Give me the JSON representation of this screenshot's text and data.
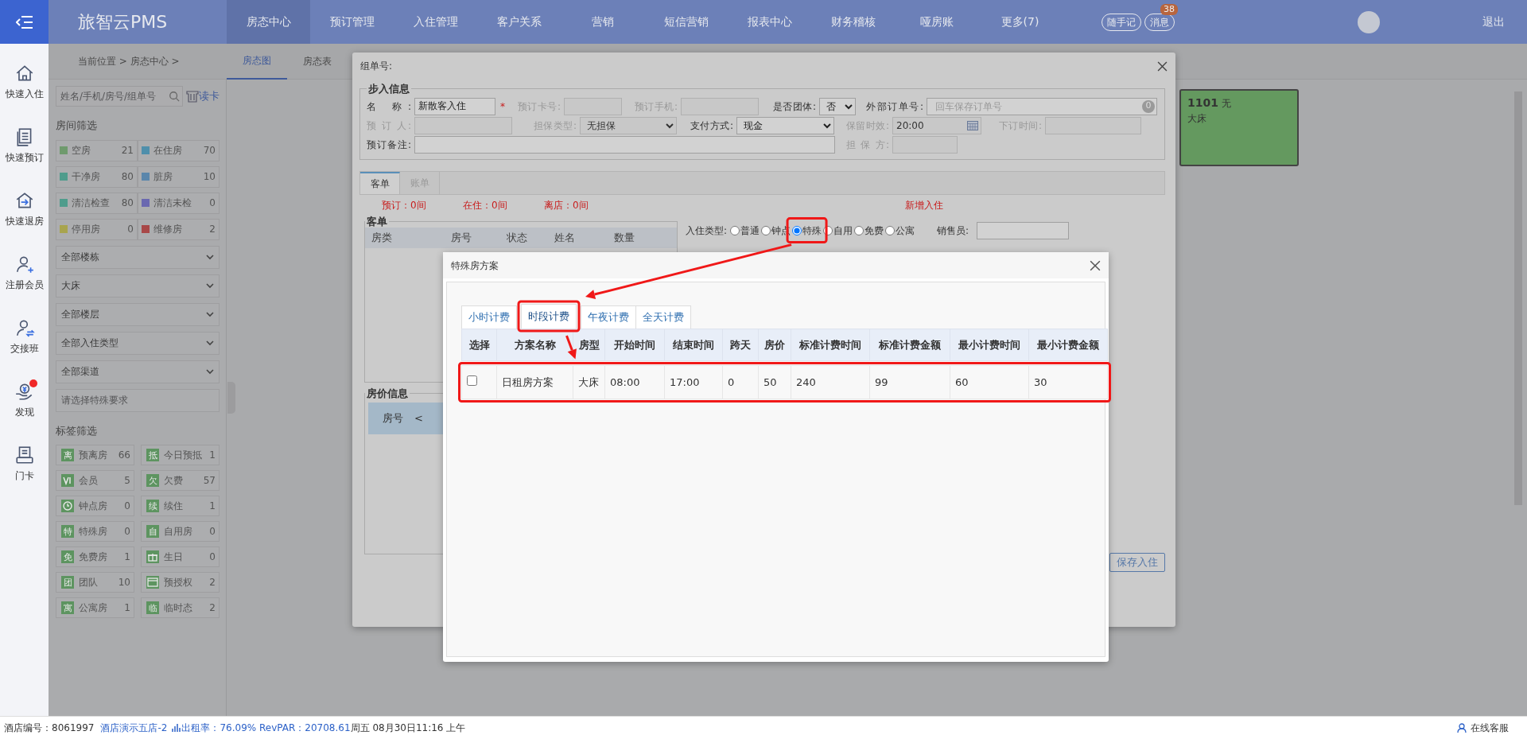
{
  "top_nav": {
    "logo": "旅智云PMS",
    "items": [
      {
        "label": "房态中心",
        "selected": true
      },
      {
        "label": "预订管理",
        "selected": false
      },
      {
        "label": "入住管理",
        "selected": false
      },
      {
        "label": "客户关系",
        "selected": false
      },
      {
        "label": "营销",
        "selected": false
      },
      {
        "label": "短信营销",
        "selected": false
      },
      {
        "label": "报表中心",
        "selected": false
      },
      {
        "label": "财务稽核",
        "selected": false
      },
      {
        "label": "哑房账",
        "selected": false
      },
      {
        "label": "更多(7)",
        "selected": false
      }
    ],
    "notes_button": "随手记",
    "messages_button": "消息",
    "messages_count": "38",
    "logout": "退出"
  },
  "rail": [
    {
      "label": "快速入住",
      "kind": "home",
      "badge_dot": false
    },
    {
      "label": "快速预订",
      "kind": "list",
      "badge_dot": false
    },
    {
      "label": "快速退房",
      "kind": "exit",
      "badge_dot": false
    },
    {
      "label": "注册会员",
      "kind": "user-add",
      "badge_dot": false
    },
    {
      "label": "交接班",
      "kind": "user-swap",
      "badge_dot": false
    },
    {
      "label": "发现",
      "kind": "money-hand",
      "badge_dot": true
    },
    {
      "label": "门卡",
      "kind": "card",
      "badge_dot": false
    }
  ],
  "breadcrumb": {
    "path": "当前位置 > 房态中心 >",
    "tabs": [
      {
        "label": "房态图",
        "selected": true
      },
      {
        "label": "房态表",
        "selected": false
      }
    ]
  },
  "filter_panel": {
    "search_placeholder": "姓名/手机/房号/组单号",
    "read_card": "读卡",
    "room_filter_title": "房间筛选",
    "room_statuses": [
      {
        "label": "空房",
        "count": "21",
        "color": "#6f9a6d"
      },
      {
        "label": "在住房",
        "count": "70",
        "color": "#4f8fab"
      },
      {
        "label": "干净房",
        "count": "80",
        "color": "#4f9c8c"
      },
      {
        "label": "脏房",
        "count": "10",
        "color": "#5a86ab"
      },
      {
        "label": "清洁检查",
        "count": "80",
        "color": "#4f9c8c"
      },
      {
        "label": "清洁未检",
        "count": "0",
        "color": "#6a68b0"
      },
      {
        "label": "停用房",
        "count": "0",
        "color": "#a8a44e"
      },
      {
        "label": "维修房",
        "count": "2",
        "color": "#a84848"
      }
    ],
    "selects": [
      "全部楼栋",
      "大床",
      "全部楼层",
      "全部入住类型",
      "全部渠道"
    ],
    "special_placeholder": "请选择特殊要求",
    "tag_filter_title": "标签筛选",
    "tags": [
      {
        "kind": "char",
        "glyph": "离",
        "label": "预离房",
        "count": "66"
      },
      {
        "kind": "char",
        "glyph": "抵",
        "label": "今日预抵",
        "count": "1"
      },
      {
        "kind": "vip",
        "label": "会员",
        "count": "5"
      },
      {
        "kind": "char",
        "glyph": "欠",
        "label": "欠费",
        "count": "57"
      },
      {
        "kind": "clock",
        "label": "钟点房",
        "count": "0"
      },
      {
        "kind": "char",
        "glyph": "续",
        "label": "续住",
        "count": "1"
      },
      {
        "kind": "char",
        "glyph": "特",
        "label": "特殊房",
        "count": "0"
      },
      {
        "kind": "char",
        "glyph": "自",
        "label": "自用房",
        "count": "0"
      },
      {
        "kind": "char",
        "glyph": "免",
        "label": "免费房",
        "count": "1"
      },
      {
        "kind": "gift",
        "label": "生日",
        "count": "0"
      },
      {
        "kind": "char",
        "glyph": "团",
        "label": "团队",
        "count": "10"
      },
      {
        "kind": "card",
        "label": "预授权",
        "count": "2"
      },
      {
        "kind": "char",
        "glyph": "寓",
        "label": "公寓房",
        "count": "1"
      },
      {
        "kind": "char",
        "glyph": "临",
        "label": "临时态",
        "count": "2"
      }
    ]
  },
  "room_cards": [
    {
      "number": "1101",
      "status": "无",
      "room_type": "大床"
    }
  ],
  "checkin_dialog": {
    "title": "组单号:",
    "booking_info": {
      "legend": "步入信息",
      "fields": [
        {
          "label": "名 称:",
          "kind": "text",
          "value": "新散客入住",
          "required_mark": "*",
          "disabled": false
        },
        {
          "label": "预订卡号:",
          "kind": "text",
          "disabled": true
        },
        {
          "label": "预订手机:",
          "kind": "text",
          "disabled": true
        },
        {
          "label": "是否团体:",
          "kind": "select",
          "value": "否",
          "disabled": false
        },
        {
          "label": "外部订单号:",
          "kind": "text",
          "placeholder": "回车保存订单号",
          "badge": "0",
          "disabled": false
        },
        {
          "label": "预 订 人:",
          "kind": "text",
          "disabled": true
        },
        {
          "label": "担保类型:",
          "kind": "select",
          "value": "无担保",
          "disabled": true
        },
        {
          "label": "支付方式:",
          "kind": "select",
          "value": "现金",
          "disabled": false
        },
        {
          "label": "保留时效:",
          "kind": "date",
          "value": "20:00",
          "disabled": true
        },
        {
          "label": "下订时间:",
          "kind": "text",
          "disabled": true
        },
        {
          "label": "预订备注:",
          "kind": "text",
          "disabled": false
        },
        {
          "label": "担 保 方:",
          "kind": "text",
          "disabled": true
        }
      ]
    },
    "tabs": [
      {
        "label": "客单",
        "selected": true
      },
      {
        "label": "账单",
        "selected": false
      }
    ],
    "counts": [
      "预订：0间",
      "在住：0间",
      "离店：0间"
    ],
    "new_checkin": "新增入住",
    "guest_list": {
      "legend": "客单",
      "columns": [
        "房类",
        "房号",
        "状态",
        "姓名",
        "数量"
      ]
    },
    "price_info": {
      "legend": "房价信息",
      "columns": [
        "房号",
        "<"
      ]
    },
    "checkin_type": {
      "label": "入住类型:",
      "options": [
        {
          "label": "普通",
          "selected": false
        },
        {
          "label": "钟点",
          "selected": false
        },
        {
          "label": "特殊",
          "selected": true
        },
        {
          "label": "自用",
          "selected": false
        },
        {
          "label": "免费",
          "selected": false
        },
        {
          "label": "公寓",
          "selected": false
        }
      ]
    },
    "salesperson": {
      "label": "销售员:"
    },
    "save_button": "保存入住"
  },
  "plan_dialog": {
    "title": "特殊房方案",
    "tabs": [
      {
        "label": "小时计费",
        "selected": false
      },
      {
        "label": "时段计费",
        "selected": true
      },
      {
        "label": "午夜计费",
        "selected": false
      },
      {
        "label": "全天计费",
        "selected": false
      }
    ],
    "select_column": "选择",
    "columns": [
      "方案名称",
      "房型",
      "开始时间",
      "结束时间",
      "跨天",
      "房价",
      "标准计费时间",
      "标准计费金额",
      "最小计费时间",
      "最小计费金额"
    ],
    "rows": [
      {
        "checked": false,
        "cells": [
          "日租房方案",
          "大床",
          "08:00",
          "17:00",
          "0",
          "50",
          "240",
          "99",
          "60",
          "30"
        ]
      }
    ]
  },
  "status_bar": {
    "hotel_id": "酒店编号：8061997",
    "hotel_name": "酒店演示五店-2",
    "occupancy": "出租率：76.09% RevPAR：20708.61",
    "datetime": "周五 08月30日11:16 上午",
    "support": "在线客服"
  }
}
